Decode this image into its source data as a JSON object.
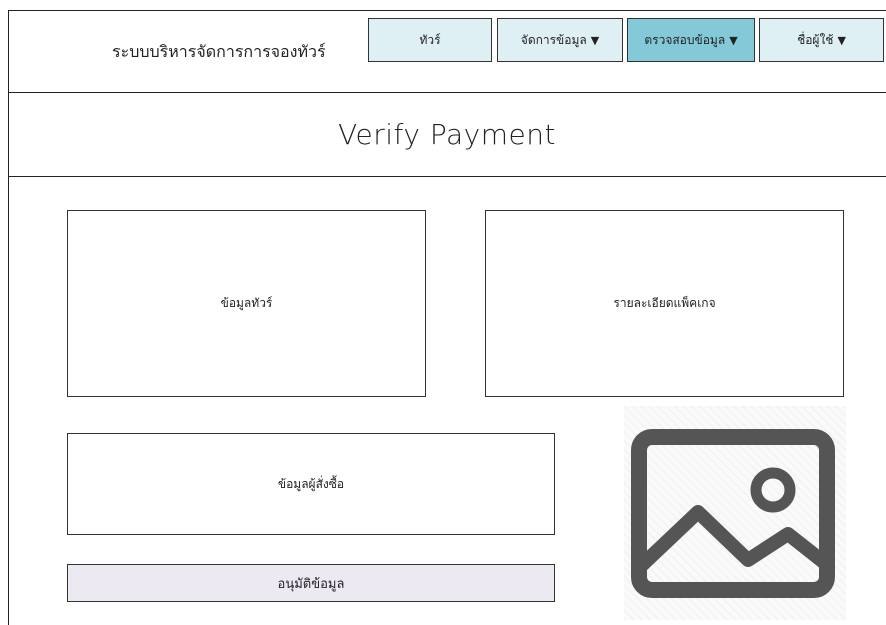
{
  "header": {
    "app_title": "ระบบบริหารจัดการการจองทัวร์",
    "nav": [
      {
        "label": "ทัวร์",
        "caret": "",
        "active": false
      },
      {
        "label": "จัดการข้อมูล",
        "caret": "▼",
        "active": false
      },
      {
        "label": "ตรวจสอบข้อมูล",
        "caret": "▼",
        "active": true
      },
      {
        "label": "ชื่อผู้ใช้",
        "caret": "▼",
        "active": false
      }
    ]
  },
  "page": {
    "title": "Verify Payment"
  },
  "panels": {
    "tour_info": "ข้อมูลทัวร์",
    "package_details": "รายละเอียดแพ็คเกจ",
    "buyer_info": "ข้อมูลผู้สั่งซื้อ"
  },
  "actions": {
    "approve_label": "อนุมัติข้อมูล"
  },
  "image": {
    "icon": "image-placeholder-icon"
  },
  "colors": {
    "nav_default": "#dff0f4",
    "nav_active": "#84c9d8",
    "approve_button": "#ece9f2",
    "icon": "#555555"
  }
}
